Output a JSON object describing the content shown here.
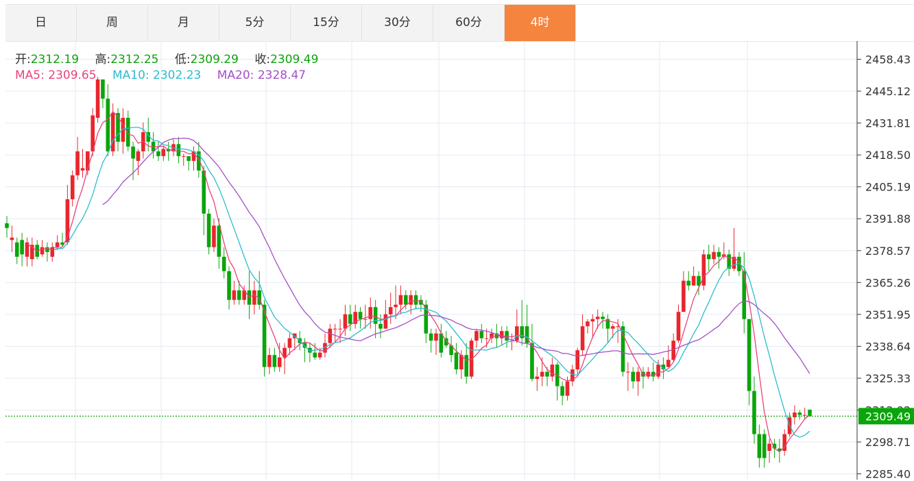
{
  "timeframes": [
    {
      "id": "day",
      "label": "日"
    },
    {
      "id": "week",
      "label": "周"
    },
    {
      "id": "month",
      "label": "月"
    },
    {
      "id": "5min",
      "label": "5分"
    },
    {
      "id": "15min",
      "label": "15分"
    },
    {
      "id": "30min",
      "label": "30分"
    },
    {
      "id": "60min",
      "label": "60分"
    },
    {
      "id": "4hour",
      "label": "4时"
    }
  ],
  "active_timeframe": "4时",
  "ohlc": {
    "open_label": "开:",
    "open": "2312.19",
    "high_label": "高:",
    "high": "2312.25",
    "low_label": "低:",
    "low": "2309.29",
    "close_label": "收:",
    "close": "2309.49"
  },
  "ma": {
    "ma5_label": "MA5:",
    "ma5": "2309.65",
    "ma10_label": "MA10:",
    "ma10": "2302.23",
    "ma20_label": "MA20:",
    "ma20": "2328.47"
  },
  "colors": {
    "up": "#e8262d",
    "down": "#0aa50a",
    "ma5": "#e8437b",
    "ma10": "#2bbccc",
    "ma20": "#a44fc4",
    "grid": "#e4eaf2",
    "accent": "#f5843f",
    "last_price": "#0aa50a"
  },
  "chart_data": {
    "type": "candlestick",
    "ylim": [
      2283.0,
      2466.0
    ],
    "y_ticks": [
      "2458.43",
      "2445.12",
      "2431.81",
      "2418.50",
      "2405.19",
      "2391.88",
      "2378.57",
      "2365.26",
      "2351.95",
      "2338.64",
      "2325.33",
      "2312.02",
      "2298.71",
      "2285.40"
    ],
    "last_price": "2309.49",
    "candles": [
      [
        2390,
        2388,
        2393,
        2384
      ],
      [
        2383,
        2384,
        2389,
        2378
      ],
      [
        2382,
        2376,
        2384,
        2373
      ],
      [
        2383,
        2377,
        2386,
        2372
      ],
      [
        2376,
        2382,
        2384,
        2372
      ],
      [
        2375,
        2381,
        2384,
        2372
      ],
      [
        2381,
        2376,
        2383,
        2375
      ],
      [
        2377,
        2380,
        2383,
        2376
      ],
      [
        2380,
        2378,
        2382,
        2374
      ],
      [
        2376,
        2380,
        2382,
        2374
      ],
      [
        2380,
        2382,
        2385,
        2379
      ],
      [
        2382,
        2381,
        2386,
        2380
      ],
      [
        2382,
        2400,
        2406,
        2381
      ],
      [
        2400,
        2410,
        2412,
        2397
      ],
      [
        2410,
        2420,
        2426,
        2408
      ],
      [
        2412,
        2413,
        2421,
        2409
      ],
      [
        2412,
        2420,
        2420,
        2410
      ],
      [
        2420,
        2435,
        2438,
        2418
      ],
      [
        2434,
        2450,
        2451,
        2432
      ],
      [
        2450,
        2442,
        2450,
        2438
      ],
      [
        2442,
        2420,
        2448,
        2418
      ],
      [
        2420,
        2436,
        2440,
        2418
      ],
      [
        2436,
        2424,
        2438,
        2420
      ],
      [
        2424,
        2434,
        2438,
        2419
      ],
      [
        2434,
        2422,
        2437,
        2420
      ],
      [
        2422,
        2417,
        2424,
        2408
      ],
      [
        2416,
        2420,
        2421,
        2410
      ],
      [
        2420,
        2428,
        2432,
        2417
      ],
      [
        2428,
        2424,
        2434,
        2420
      ],
      [
        2424,
        2420,
        2428,
        2417
      ],
      [
        2420,
        2418,
        2424,
        2416
      ],
      [
        2418,
        2421,
        2422,
        2416
      ],
      [
        2421,
        2420,
        2424,
        2416
      ],
      [
        2420,
        2423,
        2425,
        2418
      ],
      [
        2423,
        2418,
        2426,
        2415
      ],
      [
        2418,
        2418,
        2419,
        2414
      ],
      [
        2418,
        2416,
        2418,
        2412
      ],
      [
        2416,
        2420,
        2422,
        2412
      ],
      [
        2420,
        2412,
        2424,
        2409
      ],
      [
        2412,
        2394,
        2414,
        2385
      ],
      [
        2394,
        2380,
        2396,
        2377
      ],
      [
        2380,
        2389,
        2392,
        2378
      ],
      [
        2389,
        2376,
        2392,
        2371
      ],
      [
        2376,
        2370,
        2380,
        2367
      ],
      [
        2370,
        2358,
        2372,
        2354
      ],
      [
        2358,
        2362,
        2366,
        2356
      ],
      [
        2362,
        2358,
        2366,
        2356
      ],
      [
        2358,
        2362,
        2364,
        2356
      ],
      [
        2362,
        2356,
        2370,
        2350
      ],
      [
        2356,
        2362,
        2366,
        2352
      ],
      [
        2362,
        2356,
        2370,
        2354
      ],
      [
        2356,
        2330,
        2358,
        2326
      ],
      [
        2330,
        2335,
        2338,
        2327
      ],
      [
        2335,
        2330,
        2338,
        2328
      ],
      [
        2330,
        2334,
        2340,
        2328
      ],
      [
        2334,
        2338,
        2340,
        2327
      ],
      [
        2338,
        2342,
        2344,
        2335
      ],
      [
        2342,
        2344,
        2344,
        2337
      ],
      [
        2342,
        2340,
        2345,
        2337
      ],
      [
        2340,
        2338,
        2342,
        2332
      ],
      [
        2338,
        2336,
        2340,
        2332
      ],
      [
        2336,
        2334,
        2340,
        2333
      ],
      [
        2334,
        2336,
        2338,
        2333
      ],
      [
        2336,
        2340,
        2344,
        2334
      ],
      [
        2340,
        2346,
        2348,
        2338
      ],
      [
        2346,
        2346,
        2348,
        2340
      ],
      [
        2346,
        2346,
        2350,
        2340
      ],
      [
        2346,
        2352,
        2356,
        2343
      ],
      [
        2352,
        2348,
        2356,
        2345
      ],
      [
        2348,
        2353,
        2356,
        2346
      ],
      [
        2353,
        2350,
        2355,
        2346
      ],
      [
        2350,
        2350,
        2356,
        2346
      ],
      [
        2350,
        2355,
        2359,
        2346
      ],
      [
        2355,
        2348,
        2358,
        2342
      ],
      [
        2348,
        2346,
        2352,
        2342
      ],
      [
        2346,
        2352,
        2358,
        2346
      ],
      [
        2352,
        2355,
        2361,
        2348
      ],
      [
        2355,
        2356,
        2364,
        2350
      ],
      [
        2356,
        2360,
        2364,
        2352
      ],
      [
        2360,
        2356,
        2362,
        2354
      ],
      [
        2356,
        2360,
        2362,
        2352
      ],
      [
        2360,
        2356,
        2362,
        2354
      ],
      [
        2358,
        2356,
        2360,
        2353
      ],
      [
        2356,
        2344,
        2358,
        2340
      ],
      [
        2344,
        2341,
        2346,
        2336
      ],
      [
        2341,
        2344,
        2346,
        2335
      ],
      [
        2344,
        2336,
        2348,
        2334
      ],
      [
        2342,
        2339,
        2345,
        2338
      ],
      [
        2339,
        2335,
        2343,
        2332
      ],
      [
        2336,
        2329,
        2340,
        2327
      ],
      [
        2329,
        2335,
        2337,
        2325
      ],
      [
        2335,
        2326,
        2340,
        2323
      ],
      [
        2326,
        2341,
        2342,
        2325
      ],
      [
        2341,
        2345,
        2346,
        2338
      ],
      [
        2345,
        2342,
        2348,
        2340
      ],
      [
        2342,
        2342,
        2346,
        2338
      ],
      [
        2342,
        2344,
        2346,
        2340
      ],
      [
        2344,
        2342,
        2348,
        2338
      ],
      [
        2342,
        2345,
        2347,
        2339
      ],
      [
        2345,
        2341,
        2347,
        2338
      ],
      [
        2341,
        2341,
        2344,
        2337
      ],
      [
        2341,
        2347,
        2354,
        2340
      ],
      [
        2347,
        2342,
        2358,
        2339
      ],
      [
        2347,
        2340,
        2356,
        2338
      ],
      [
        2340,
        2325,
        2348,
        2324
      ],
      [
        2325,
        2326,
        2330,
        2320
      ],
      [
        2326,
        2328,
        2334,
        2322
      ],
      [
        2328,
        2326,
        2330,
        2322
      ],
      [
        2326,
        2331,
        2334,
        2324
      ],
      [
        2331,
        2322,
        2332,
        2316
      ],
      [
        2322,
        2318,
        2324,
        2314
      ],
      [
        2318,
        2324,
        2326,
        2316
      ],
      [
        2324,
        2329,
        2331,
        2322
      ],
      [
        2329,
        2337,
        2338,
        2327
      ],
      [
        2337,
        2347,
        2352,
        2335
      ],
      [
        2347,
        2349,
        2350,
        2344
      ],
      [
        2349,
        2350,
        2352,
        2342
      ],
      [
        2350,
        2351,
        2354,
        2346
      ],
      [
        2351,
        2350,
        2353,
        2346
      ],
      [
        2350,
        2346,
        2352,
        2340
      ],
      [
        2346,
        2347,
        2348,
        2342
      ],
      [
        2347,
        2347,
        2350,
        2340
      ],
      [
        2347,
        2328,
        2349,
        2326
      ],
      [
        2328,
        2328,
        2332,
        2320
      ],
      [
        2328,
        2324,
        2330,
        2321
      ],
      [
        2324,
        2328,
        2330,
        2318
      ],
      [
        2328,
        2326,
        2330,
        2321
      ],
      [
        2326,
        2328,
        2330,
        2325
      ],
      [
        2328,
        2326,
        2332,
        2324
      ],
      [
        2326,
        2331,
        2333,
        2325
      ],
      [
        2331,
        2329,
        2334,
        2325
      ],
      [
        2330,
        2333,
        2339,
        2330
      ],
      [
        2333,
        2341,
        2344,
        2332
      ],
      [
        2341,
        2353,
        2356,
        2340
      ],
      [
        2353,
        2366,
        2370,
        2355
      ],
      [
        2366,
        2364,
        2370,
        2362
      ],
      [
        2364,
        2368,
        2372,
        2364
      ],
      [
        2368,
        2364,
        2370,
        2360
      ],
      [
        2364,
        2377,
        2379,
        2362
      ],
      [
        2377,
        2375,
        2381,
        2370
      ],
      [
        2375,
        2378,
        2381,
        2373
      ],
      [
        2378,
        2376,
        2380,
        2371
      ],
      [
        2376,
        2377,
        2382,
        2375
      ],
      [
        2377,
        2371,
        2379,
        2368
      ],
      [
        2371,
        2376,
        2388,
        2370
      ],
      [
        2376,
        2370,
        2378,
        2368
      ],
      [
        2370,
        2350,
        2378,
        2344
      ],
      [
        2350,
        2320,
        2350,
        2314
      ],
      [
        2320,
        2302,
        2326,
        2298
      ],
      [
        2302,
        2292,
        2306,
        2288
      ],
      [
        2302,
        2292,
        2304,
        2288
      ],
      [
        2295,
        2298,
        2300,
        2290
      ],
      [
        2298,
        2296,
        2300,
        2292
      ],
      [
        2296,
        2295,
        2300,
        2290
      ],
      [
        2295,
        2302,
        2304,
        2293
      ],
      [
        2302,
        2309,
        2311,
        2301
      ],
      [
        2309,
        2311,
        2314,
        2306
      ],
      [
        2311,
        2310,
        2312,
        2308
      ],
      [
        2310,
        2310,
        2313,
        2308
      ],
      [
        2312.19,
        2309.49,
        2312.25,
        2309.29
      ]
    ]
  }
}
